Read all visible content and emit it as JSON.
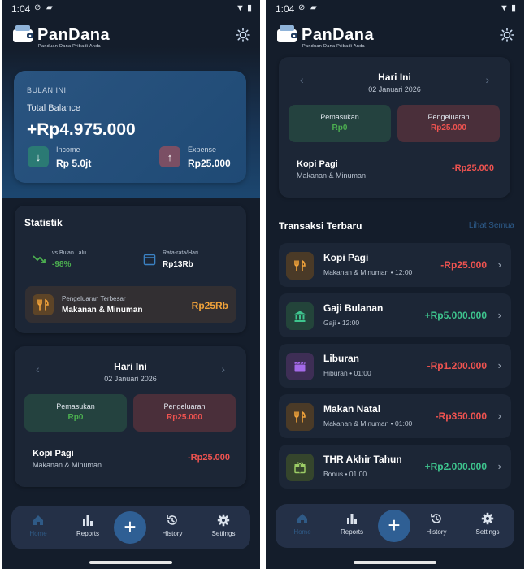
{
  "status": {
    "time": "1:04"
  },
  "app": {
    "name": "PanDana",
    "tagline": "Panduan Dana Pribadi Anda"
  },
  "balance": {
    "period_label": "BULAN INI",
    "title": "Total Balance",
    "value": "+Rp4.975.000",
    "income_label": "Income",
    "income_value": "Rp 5.0jt",
    "expense_label": "Expense",
    "expense_value": "Rp25.000"
  },
  "statistik": {
    "title": "Statistik",
    "vs_label": "vs Bulan Lalu",
    "vs_value": "-98%",
    "avg_label": "Rata-rata/Hari",
    "avg_value": "Rp13Rb",
    "biggest_label": "Pengeluaran Terbesar",
    "biggest_category": "Makanan & Minuman",
    "biggest_value": "Rp25Rb"
  },
  "today": {
    "title": "Hari Ini",
    "date": "02 Januari 2026",
    "income_label": "Pemasukan",
    "income_value": "Rp0",
    "expense_label": "Pengeluaran",
    "expense_value": "Rp25.000",
    "item_name": "Kopi Pagi",
    "item_category": "Makanan & Minuman",
    "item_value": "-Rp25.000"
  },
  "recent": {
    "title": "Transaksi Terbaru",
    "see_all": "Lihat Semua",
    "items": [
      {
        "name": "Kopi Pagi",
        "sub": "Makanan & Minuman • 12:00",
        "amount": "-Rp25.000",
        "icon": "fork-knife-icon"
      },
      {
        "name": "Gaji Bulanan",
        "sub": "Gaji • 12:00",
        "amount": "+Rp5.000.000",
        "icon": "bank-icon"
      },
      {
        "name": "Liburan",
        "sub": "Hiburan • 01:00",
        "amount": "-Rp1.200.000",
        "icon": "clapperboard-icon"
      },
      {
        "name": "Makan Natal",
        "sub": "Makanan & Minuman • 01:00",
        "amount": "-Rp350.000",
        "icon": "fork-knife-icon"
      },
      {
        "name": "THR Akhir Tahun",
        "sub": "Bonus • 01:00",
        "amount": "+Rp2.000.000",
        "icon": "gift-icon"
      }
    ]
  },
  "nav": {
    "home": "Home",
    "reports": "Reports",
    "history": "History",
    "settings": "Settings",
    "add": "+"
  },
  "colors": {
    "background": "#141d2b",
    "card": "#1c2636",
    "accent": "#2f5f94",
    "income": "#4caf50",
    "expense": "#ef5350",
    "highlight": "#f0a23a"
  }
}
